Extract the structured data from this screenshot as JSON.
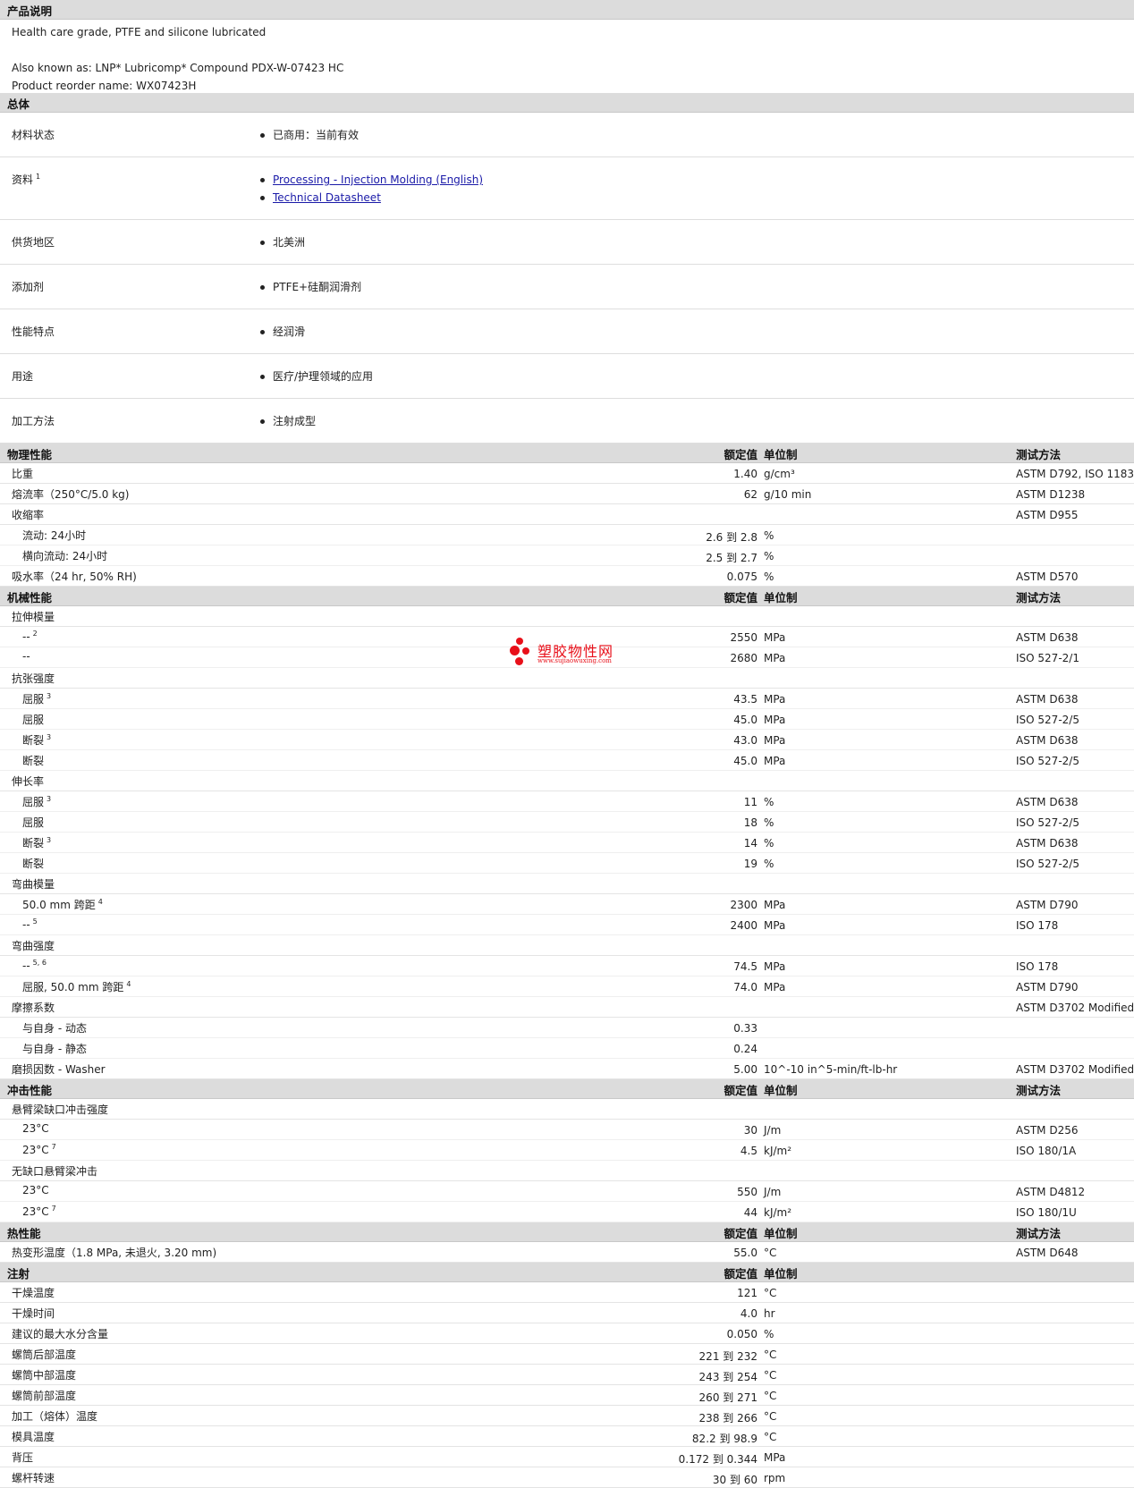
{
  "desc": {
    "title": "产品说明",
    "line1": "Health care grade, PTFE and silicone lubricated",
    "line2": "Also known as: LNP* Lubricomp* Compound PDX-W-07423 HC",
    "line3": "Product reorder name: WX07423H"
  },
  "general": {
    "title": "总体",
    "rows": [
      {
        "label": "材料状态",
        "sup": "",
        "items": [
          {
            "text": "已商用：当前有效",
            "link": false
          }
        ]
      },
      {
        "label": "资料",
        "sup": "1",
        "items": [
          {
            "text": "Processing - Injection Molding (English)",
            "link": true
          },
          {
            "text": "Technical Datasheet",
            "link": true
          }
        ]
      },
      {
        "label": "供货地区",
        "sup": "",
        "items": [
          {
            "text": "北美洲",
            "link": false
          }
        ]
      },
      {
        "label": "添加剂",
        "sup": "",
        "items": [
          {
            "text": "PTFE+硅酮润滑剂",
            "link": false
          }
        ]
      },
      {
        "label": "性能特点",
        "sup": "",
        "items": [
          {
            "text": "经润滑",
            "link": false
          }
        ]
      },
      {
        "label": "用途",
        "sup": "",
        "items": [
          {
            "text": "医疗/护理领域的应用",
            "link": false
          }
        ]
      },
      {
        "label": "加工方法",
        "sup": "",
        "items": [
          {
            "text": "注射成型",
            "link": false
          }
        ]
      }
    ]
  },
  "headers": {
    "nominal": "额定值",
    "unit": "单位制",
    "method": "测试方法"
  },
  "sections": [
    {
      "title": "物理性能",
      "show_method": true,
      "rows": [
        {
          "label": "比重",
          "value": "1.40",
          "unit": "g/cm³",
          "method": "ASTM D792, ISO 1183"
        },
        {
          "label": "熔流率（250°C/5.0 kg)",
          "value": "62",
          "unit": "g/10 min",
          "method": "ASTM D1238"
        },
        {
          "label": "收缩率",
          "value": "",
          "unit": "",
          "method": "ASTM D955"
        },
        {
          "label": "流动: 24小时",
          "indent": true,
          "value": "2.6 到 2.8",
          "unit": "%",
          "method": ""
        },
        {
          "label": "横向流动: 24小时",
          "indent": true,
          "value": "2.5 到 2.7",
          "unit": "%",
          "method": ""
        },
        {
          "label": "吸水率（24 hr, 50% RH)",
          "value": "0.075",
          "unit": "%",
          "method": "ASTM D570"
        }
      ]
    },
    {
      "title": "机械性能",
      "show_method": true,
      "rows": [
        {
          "label": "拉伸模量",
          "value": "",
          "unit": "",
          "method": ""
        },
        {
          "label": "--",
          "sup": "2",
          "indent": true,
          "value": "2550",
          "unit": "MPa",
          "method": "ASTM D638"
        },
        {
          "label": "--",
          "indent": true,
          "value": "2680",
          "unit": "MPa",
          "method": "ISO 527-2/1"
        },
        {
          "label": "抗张强度",
          "value": "",
          "unit": "",
          "method": ""
        },
        {
          "label": "屈服",
          "sup": "3",
          "indent": true,
          "value": "43.5",
          "unit": "MPa",
          "method": "ASTM D638"
        },
        {
          "label": "屈服",
          "indent": true,
          "value": "45.0",
          "unit": "MPa",
          "method": "ISO 527-2/5"
        },
        {
          "label": "断裂",
          "sup": "3",
          "indent": true,
          "value": "43.0",
          "unit": "MPa",
          "method": "ASTM D638"
        },
        {
          "label": "断裂",
          "indent": true,
          "value": "45.0",
          "unit": "MPa",
          "method": "ISO 527-2/5"
        },
        {
          "label": "伸长率",
          "value": "",
          "unit": "",
          "method": ""
        },
        {
          "label": "屈服",
          "sup": "3",
          "indent": true,
          "value": "11",
          "unit": "%",
          "method": "ASTM D638"
        },
        {
          "label": "屈服",
          "indent": true,
          "value": "18",
          "unit": "%",
          "method": "ISO 527-2/5"
        },
        {
          "label": "断裂",
          "sup": "3",
          "indent": true,
          "value": "14",
          "unit": "%",
          "method": "ASTM D638"
        },
        {
          "label": "断裂",
          "indent": true,
          "value": "19",
          "unit": "%",
          "method": "ISO 527-2/5"
        },
        {
          "label": "弯曲模量",
          "value": "",
          "unit": "",
          "method": ""
        },
        {
          "label": "50.0 mm 跨距",
          "sup": "4",
          "indent": true,
          "value": "2300",
          "unit": "MPa",
          "method": "ASTM D790"
        },
        {
          "label": "--",
          "sup": "5",
          "indent": true,
          "value": "2400",
          "unit": "MPa",
          "method": "ISO 178"
        },
        {
          "label": "弯曲强度",
          "value": "",
          "unit": "",
          "method": ""
        },
        {
          "label": "--",
          "sup": "5, 6",
          "indent": true,
          "value": "74.5",
          "unit": "MPa",
          "method": "ISO 178"
        },
        {
          "label": "屈服, 50.0 mm 跨距",
          "sup": "4",
          "indent": true,
          "value": "74.0",
          "unit": "MPa",
          "method": "ASTM D790"
        },
        {
          "label": "摩擦系数",
          "value": "",
          "unit": "",
          "method": "ASTM D3702 Modified"
        },
        {
          "label": "与自身 - 动态",
          "indent": true,
          "value": "0.33",
          "unit": "",
          "method": ""
        },
        {
          "label": "与自身 - 静态",
          "indent": true,
          "value": "0.24",
          "unit": "",
          "method": ""
        },
        {
          "label": "磨损因数 - Washer",
          "value": "5.00",
          "unit": "10^-10 in^5-min/ft-lb-hr",
          "method": "ASTM D3702 Modified"
        }
      ]
    },
    {
      "title": "冲击性能",
      "show_method": true,
      "rows": [
        {
          "label": "悬臂梁缺口冲击强度",
          "value": "",
          "unit": "",
          "method": ""
        },
        {
          "label": "23°C",
          "indent": true,
          "value": "30",
          "unit": "J/m",
          "method": "ASTM D256"
        },
        {
          "label": "23°C",
          "sup": "7",
          "indent": true,
          "value": "4.5",
          "unit": "kJ/m²",
          "method": "ISO 180/1A"
        },
        {
          "label": "无缺口悬臂梁冲击",
          "value": "",
          "unit": "",
          "method": ""
        },
        {
          "label": "23°C",
          "indent": true,
          "value": "550",
          "unit": "J/m",
          "method": "ASTM D4812"
        },
        {
          "label": "23°C",
          "sup": "7",
          "indent": true,
          "value": "44",
          "unit": "kJ/m²",
          "method": "ISO 180/1U"
        }
      ]
    },
    {
      "title": "热性能",
      "show_method": true,
      "rows": [
        {
          "label": "热变形温度（1.8 MPa, 未退火, 3.20 mm)",
          "value": "55.0",
          "unit": "°C",
          "method": "ASTM D648"
        }
      ]
    },
    {
      "title": "注射",
      "show_method": false,
      "rows": [
        {
          "label": "干燥温度",
          "value": "121",
          "unit": "°C",
          "method": ""
        },
        {
          "label": "干燥时间",
          "value": "4.0",
          "unit": "hr",
          "method": ""
        },
        {
          "label": "建议的最大水分含量",
          "value": "0.050",
          "unit": "%",
          "method": ""
        },
        {
          "label": "螺筒后部温度",
          "value": "221 到 232",
          "unit": "°C",
          "method": ""
        },
        {
          "label": "螺筒中部温度",
          "value": "243 到 254",
          "unit": "°C",
          "method": ""
        },
        {
          "label": "螺筒前部温度",
          "value": "260 到 271",
          "unit": "°C",
          "method": ""
        },
        {
          "label": "加工（熔体）温度",
          "value": "238 到 266",
          "unit": "°C",
          "method": ""
        },
        {
          "label": "模具温度",
          "value": "82.2 到 98.9",
          "unit": "°C",
          "method": ""
        },
        {
          "label": "背压",
          "value": "0.172 到 0.344",
          "unit": "MPa",
          "method": ""
        },
        {
          "label": "螺杆转速",
          "value": "30 到 60",
          "unit": "rpm",
          "method": ""
        }
      ]
    }
  ],
  "watermark": {
    "name": "塑胶物性网",
    "url": "www.sujiaowuxing.com",
    "color": "#e8101a"
  }
}
